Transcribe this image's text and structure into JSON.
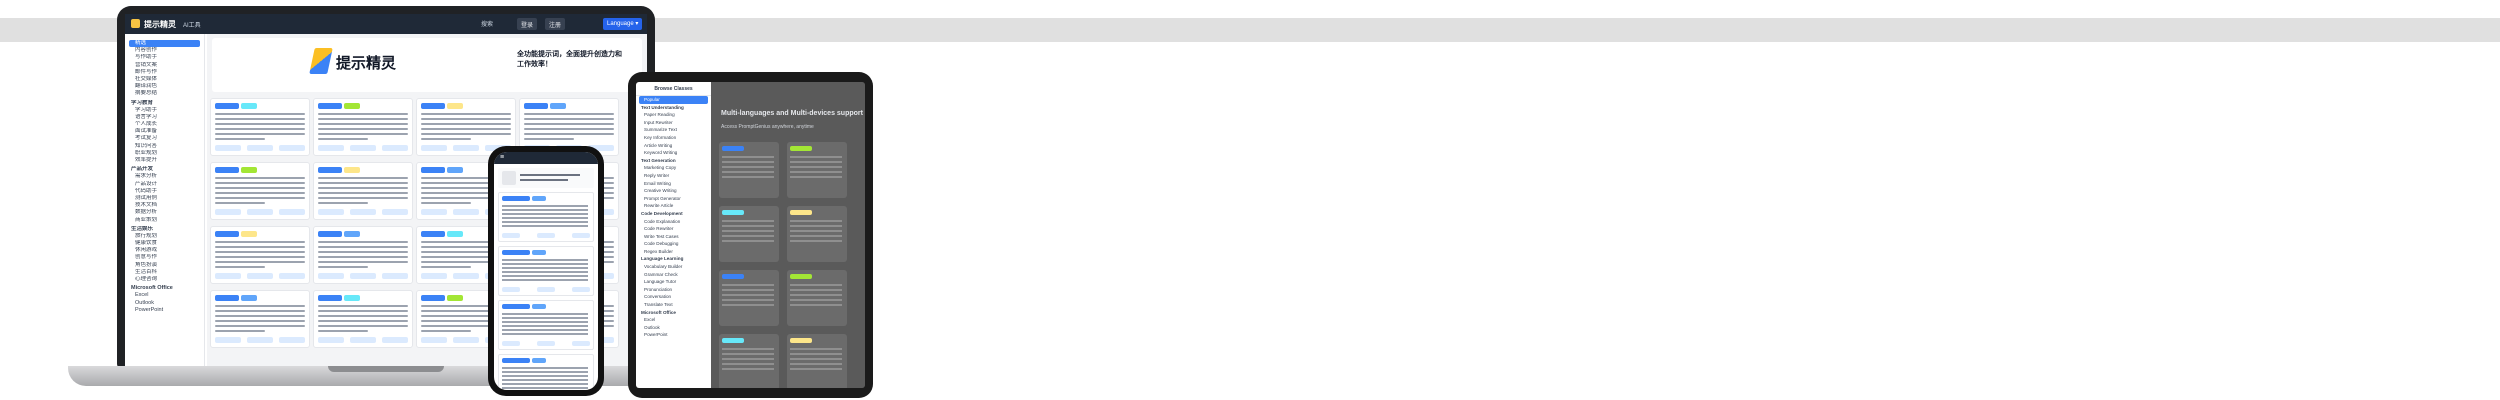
{
  "laptop": {
    "app_title": "提示精灵",
    "app_subtitle": "AI工具",
    "header_search": "搜索",
    "header_buttons": [
      "登录",
      "注册"
    ],
    "language_button": "Language ▾",
    "sidebar": [
      {
        "label": "精选",
        "active": true
      },
      {
        "label": "内容创作"
      },
      {
        "label": "写作助手"
      },
      {
        "label": "营销文案"
      },
      {
        "label": "邮件写作"
      },
      {
        "label": "社交媒体"
      },
      {
        "label": "翻译润色"
      },
      {
        "label": "摘要总结"
      },
      {
        "label": "学习教育",
        "group": true
      },
      {
        "label": "学习助手"
      },
      {
        "label": "语言学习"
      },
      {
        "label": "个人成长"
      },
      {
        "label": "面试准备"
      },
      {
        "label": "考试复习"
      },
      {
        "label": "知识问答"
      },
      {
        "label": "职业规划"
      },
      {
        "label": "效率提升"
      },
      {
        "label": "产品开发",
        "group": true
      },
      {
        "label": "需求分析"
      },
      {
        "label": "产品设计"
      },
      {
        "label": "代码助手"
      },
      {
        "label": "测试用例"
      },
      {
        "label": "技术文档"
      },
      {
        "label": "数据分析"
      },
      {
        "label": "商业策划"
      },
      {
        "label": "生活娱乐",
        "group": true
      },
      {
        "label": "旅行规划"
      },
      {
        "label": "健康饮食"
      },
      {
        "label": "休闲游戏"
      },
      {
        "label": "创意写作"
      },
      {
        "label": "角色扮演"
      },
      {
        "label": "生活百科"
      },
      {
        "label": "心理咨询"
      },
      {
        "label": "Microsoft Office",
        "group": true
      },
      {
        "label": "Excel"
      },
      {
        "label": "Outlook"
      },
      {
        "label": "PowerPoint"
      }
    ],
    "hero_title": "提示精灵",
    "hero_slogan": "全功能提示词，全面提升创造力和工作效率！"
  },
  "tablet": {
    "sidebar_header": "Browse Classes",
    "sidebar": [
      {
        "label": "Popular",
        "active": true
      },
      {
        "label": "Text Understanding",
        "group": true
      },
      {
        "label": "Paper Reading"
      },
      {
        "label": "Input Rewriter"
      },
      {
        "label": "Summarize Text"
      },
      {
        "label": "Key Information"
      },
      {
        "label": "Article Writing"
      },
      {
        "label": "Keyword Writing"
      },
      {
        "label": "Text Generation",
        "group": true
      },
      {
        "label": "Marketing Copy"
      },
      {
        "label": "Reply Writer"
      },
      {
        "label": "Email Writing"
      },
      {
        "label": "Creative Writing"
      },
      {
        "label": "Prompt Generator"
      },
      {
        "label": "Rewrite Article"
      },
      {
        "label": "Code Development",
        "group": true
      },
      {
        "label": "Code Explanation"
      },
      {
        "label": "Code Rewriter"
      },
      {
        "label": "Write Test Cases"
      },
      {
        "label": "Code Debugging"
      },
      {
        "label": "Regex Builder"
      },
      {
        "label": "Language Learning",
        "group": true
      },
      {
        "label": "Vocabulary Builder"
      },
      {
        "label": "Grammar Check"
      },
      {
        "label": "Language Tutor"
      },
      {
        "label": "Pronunciation"
      },
      {
        "label": "Conversation"
      },
      {
        "label": "Translate Text"
      },
      {
        "label": "Microsoft Office",
        "group": true
      },
      {
        "label": "Excel"
      },
      {
        "label": "Outlook"
      },
      {
        "label": "PowerPoint"
      }
    ],
    "title": "Multi-languages and Multi-devices support",
    "subtitle": "Access PromptGenius anywhere, anytime"
  },
  "phone": {
    "menu_icon": "≡"
  },
  "colors": {
    "accent": "#3b82f6",
    "header_dark": "#1f2937",
    "tag_green": "#a3e635",
    "tag_cyan": "#67e8f9",
    "tag_yellow": "#fde68a"
  }
}
